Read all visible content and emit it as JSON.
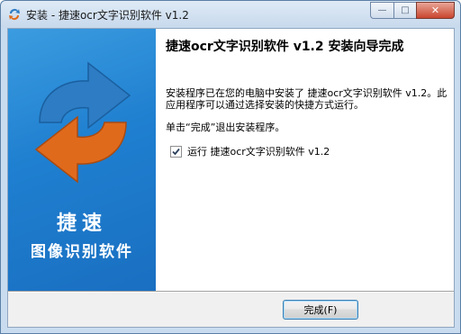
{
  "window": {
    "title": "安装 - 捷速ocr文字识别软件 v1.2",
    "controls": {
      "minimize": "—",
      "maximize": "□",
      "close": "✕"
    }
  },
  "banner": {
    "title": "捷速",
    "subtitle": "图像识别软件",
    "logo_colors": {
      "top_arrow": "#2d7cc4",
      "bottom_arrow": "#e06a1c"
    },
    "background": "#1f7fd0"
  },
  "content": {
    "heading": "捷速ocr文字识别软件 v1.2 安装向导完成",
    "description": "安装程序已在您的电脑中安装了 捷速ocr文字识别软件 v1.2。此应用程序可以通过选择安装的快捷方式运行。",
    "hint": "单击“完成”退出安装程序。",
    "run_option": {
      "label": "运行 捷速ocr文字识别软件 v1.2",
      "checked": true
    }
  },
  "footer": {
    "finish_button": "完成(F)"
  }
}
